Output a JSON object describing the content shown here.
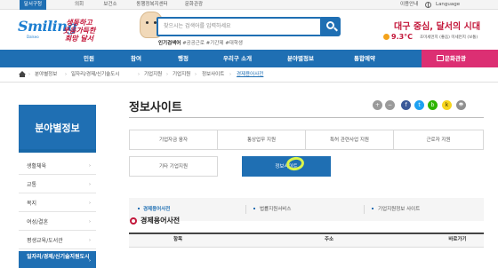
{
  "topbar": {
    "tabs": [
      "달서구청",
      "의회",
      "보건소",
      "동행정복지센터",
      "문화관광"
    ],
    "active_tab": 0,
    "links": {
      "guide": "이용안내",
      "language": "Language"
    }
  },
  "header": {
    "logo_main": "Smiling",
    "logo_sub": "Dalseo",
    "logo_slogan": "생동하고 웃음가득한 희망 달서",
    "search_placeholder": "찾으시는 검색어를 입력하세요",
    "popular_label": "인기검색어",
    "popular_terms": "#공공근로 #기간제 #대학생",
    "weather_title": "대구 중심, 달서의 시대",
    "weather_temp": "9.3°C",
    "weather_detail": "초미세먼지 (좋음) 미세먼지 (보통)"
  },
  "gnb": {
    "items": [
      "민원",
      "참여",
      "행정",
      "우리구 소개",
      "분야별정보",
      "통합예약"
    ],
    "culture_label": "문화관광"
  },
  "breadcrumb": [
    "분야별정보",
    "일자리/경제/신기술도시",
    "기업지원",
    "기업지원",
    "정보사이트",
    "경제용어사전"
  ],
  "sidebar": {
    "title": "분야별정보",
    "items": [
      "생활체육",
      "교통",
      "복지",
      "여성/결혼",
      "평생교육/도서관",
      "일자리/경제/신기술지원도시"
    ],
    "active_index": 5
  },
  "main": {
    "title": "정보사이트",
    "tools": [
      "+",
      "−",
      "f",
      "t",
      "b",
      "k",
      "🖶"
    ],
    "tabs_row1": [
      "기업자금 융자",
      "통상업무 지원",
      "특허 관련사업 지원",
      "근로자 지원"
    ],
    "tabs_row2": [
      "기타 기업지원",
      "정보사이트"
    ],
    "active_tab": "정보사이트",
    "sublinks": [
      "경제용어사전",
      "법률지원서비스",
      "기업지원정보 사이트"
    ],
    "active_sublink": 0,
    "section_title": "경제용어사전",
    "table_headers": [
      "항목",
      "주소",
      "바로가기"
    ]
  },
  "colors": {
    "primary": "#1f6fb3",
    "accent_red": "#c3173a",
    "culture_pink": "#dc2f73",
    "highlight": "#dbf54a"
  }
}
